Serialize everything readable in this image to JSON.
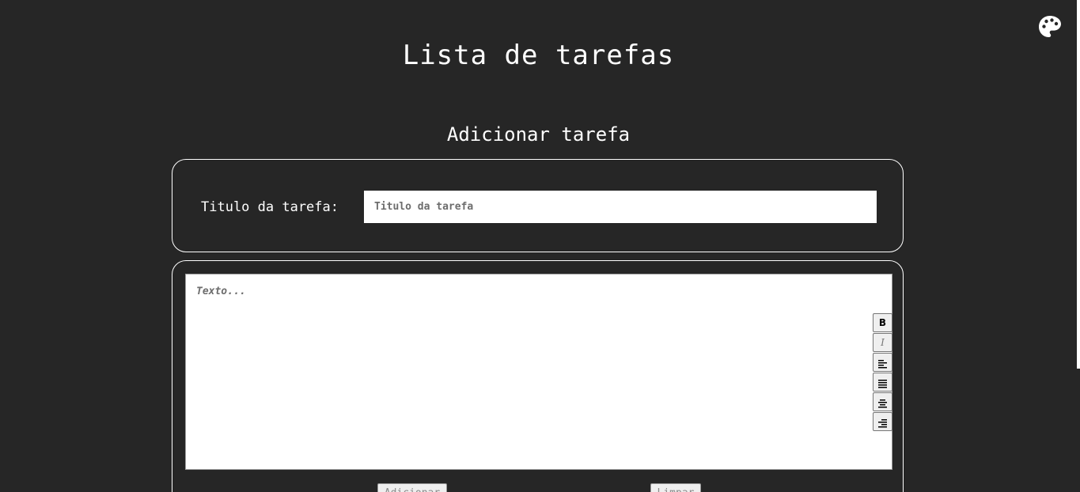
{
  "header": {
    "title": "Lista de tarefas",
    "theme_icon": "palette-icon"
  },
  "form": {
    "section_title": "Adicionar tarefa",
    "title_label": "Titulo da tarefa:",
    "title_placeholder": "Titulo da tarefa",
    "title_value": "",
    "text_placeholder": "Texto...",
    "text_value": ""
  },
  "toolbar": {
    "bold_label": "B",
    "italic_label": "I",
    "buttons": [
      {
        "name": "bold",
        "icon": "bold-icon"
      },
      {
        "name": "italic",
        "icon": "italic-icon"
      },
      {
        "name": "align-left",
        "icon": "align-left-icon"
      },
      {
        "name": "justify",
        "icon": "align-justify-icon"
      },
      {
        "name": "align-center",
        "icon": "align-center-icon"
      },
      {
        "name": "align-right",
        "icon": "align-right-icon"
      }
    ]
  },
  "actions": {
    "add_label": "Adicionar",
    "clear_label": "Limpar"
  }
}
